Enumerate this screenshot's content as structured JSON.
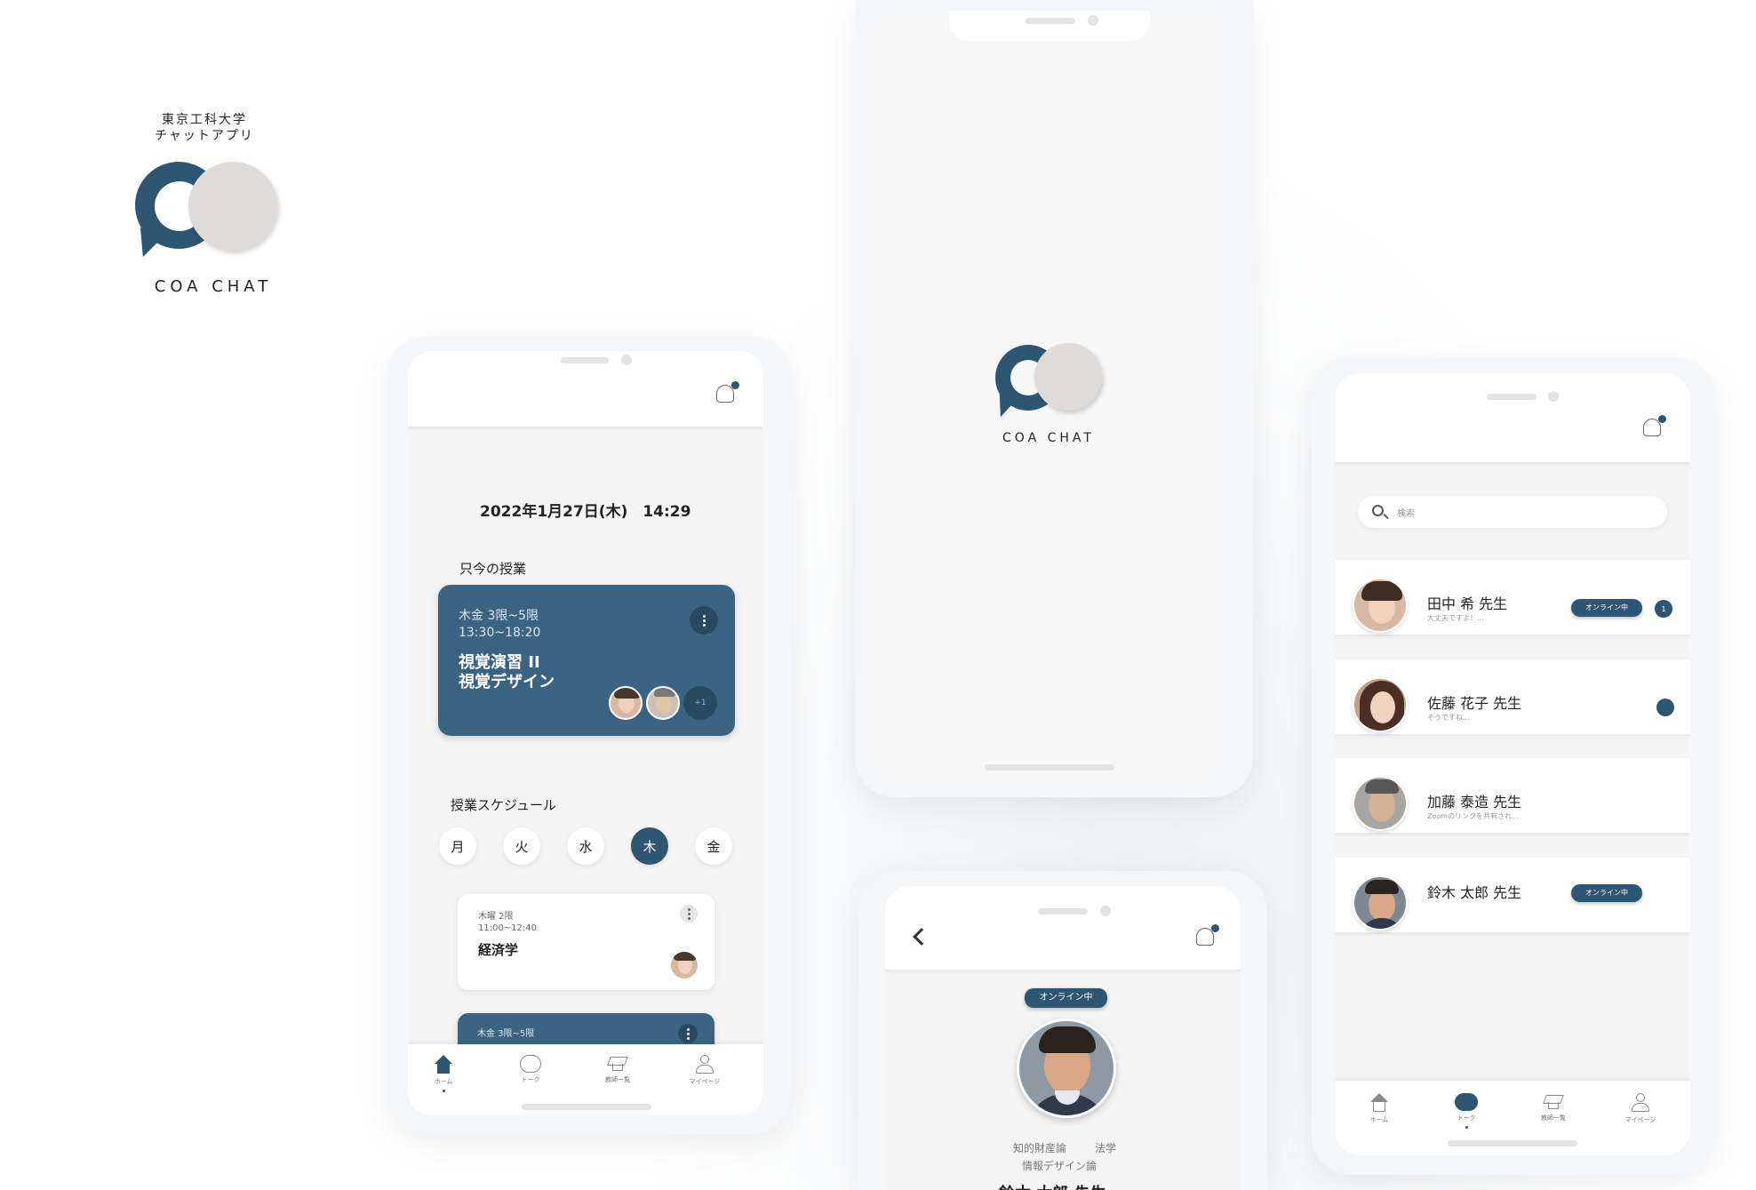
{
  "brand": {
    "university": "東京工科大学",
    "app_type": "チャットアプリ",
    "name": "COA CHAT"
  },
  "colors": {
    "accent": "#2e5673",
    "card": "#3a6481",
    "logo_light": "#dedcda"
  },
  "home": {
    "datetime": "2022年1月27日(木)　14:29",
    "current_title": "只今の授業",
    "current_class": {
      "period": "木金  3限~5限",
      "time": "13:30~18:20",
      "name_1": "視覚演習 II",
      "name_2": "視覚デザイン",
      "more": "+1"
    },
    "schedule_title": "授業スケジュール",
    "days": [
      "月",
      "火",
      "水",
      "木",
      "金"
    ],
    "active_day": "木",
    "schedule": [
      {
        "period": "木曜  2限",
        "time": "11:00~12:40",
        "name": "経済学"
      },
      {
        "period": "木金  3限~5限"
      }
    ],
    "tabs": [
      {
        "label": "ホーム",
        "icon": "home-icon",
        "active": true
      },
      {
        "label": "トーク",
        "icon": "chat-icon",
        "active": false
      },
      {
        "label": "教師一覧",
        "icon": "graduation-cap-icon",
        "active": false
      },
      {
        "label": "マイページ",
        "icon": "user-icon",
        "active": false
      }
    ]
  },
  "splash": {
    "name": "COA CHAT"
  },
  "profile": {
    "status": "オンライン中",
    "subject_1": "知的財産論",
    "subject_2": "法学",
    "subject_3": "情報デザイン論",
    "name_partial": "鈴木 太郎  先生"
  },
  "talk": {
    "search_placeholder": "検索",
    "items": [
      {
        "name": "田中 希 先生",
        "preview": "大丈夫ですよ！...",
        "online": "オンライン中",
        "badge": "1"
      },
      {
        "name": "佐藤 花子 先生",
        "preview": "そうですね...",
        "badge": ""
      },
      {
        "name": "加藤 泰造 先生",
        "preview": "Zoomのリンクを共有され..."
      },
      {
        "name": "鈴木 太郎 先生",
        "online": "オンライン中"
      }
    ],
    "tabs": [
      {
        "label": "ホーム",
        "icon": "home-icon",
        "active": false
      },
      {
        "label": "トーク",
        "icon": "chat-icon",
        "active": true
      },
      {
        "label": "教師一覧",
        "icon": "graduation-cap-icon",
        "active": false
      },
      {
        "label": "マイページ",
        "icon": "user-icon",
        "active": false
      }
    ]
  }
}
